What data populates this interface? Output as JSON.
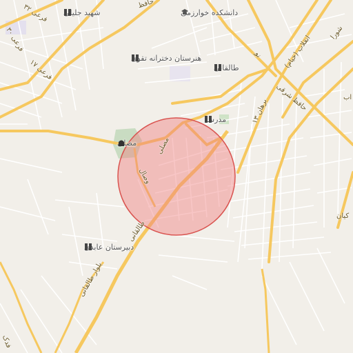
{
  "map": {
    "highlight": {
      "fill_color": "#f08080",
      "stroke_color": "#d9534f"
    },
    "colors": {
      "background": "#f2efe9",
      "major_road": "#f6c85f",
      "minor_road": "#ffffff",
      "park": "#c9dcc2"
    },
    "pois": [
      {
        "id": "university",
        "label": "دانشکده خوارزمی",
        "icon": "university-icon"
      },
      {
        "id": "school-jalili",
        "label": "شهید جلیلی",
        "icon": "school-icon"
      },
      {
        "id": "school-taghva",
        "label": "هنرستان دخترانه تقوی",
        "icon": "school-icon"
      },
      {
        "id": "school-taleghani",
        "label": "طالقانی",
        "icon": "school-icon"
      },
      {
        "id": "school-madrese",
        "label": "مدرسه",
        "icon": "school-icon"
      },
      {
        "id": "mosalla",
        "label": "مصلی",
        "icon": "monument-icon"
      },
      {
        "id": "school-abedi",
        "label": "دبیرستان عابدی",
        "icon": "school-icon"
      }
    ],
    "road_labels": [
      {
        "id": "farabi-32",
        "text": "فرعی ۳۲"
      },
      {
        "id": "farabi-30",
        "text": "فرعی ۳۰"
      },
      {
        "id": "farabi-17",
        "text": "فرعی ۱۷"
      },
      {
        "id": "shora",
        "text": "شورا"
      },
      {
        "id": "enghelab",
        "text": "انقلاب (خیام)"
      },
      {
        "id": "hafez-sharghi",
        "text": "حافظ شرقی"
      },
      {
        "id": "hafez-top",
        "text": "حافظ"
      },
      {
        "id": "no",
        "text": "نو"
      },
      {
        "id": "borhan",
        "text": "برهان ۱۳"
      },
      {
        "id": "mosalla-road",
        "text": "مصلی"
      },
      {
        "id": "vesal",
        "text": "وصال"
      },
      {
        "id": "taleghani-1",
        "text": "طالقانی"
      },
      {
        "id": "taleghani-2",
        "text": "بلوار طالقانی"
      },
      {
        "id": "partial-ab",
        "text": "اب"
      },
      {
        "id": "partial-kian",
        "text": "کیان"
      },
      {
        "id": "partial-fadak",
        "text": "فدک"
      }
    ]
  }
}
